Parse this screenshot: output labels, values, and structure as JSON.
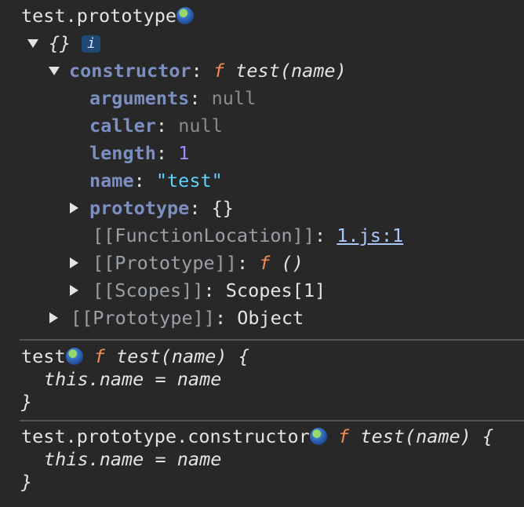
{
  "entries": [
    {
      "expression": "test.prototype",
      "tree": {
        "root": "{}",
        "info_badge": "i",
        "constructor": {
          "key": "constructor",
          "sep": ": ",
          "f": "f",
          "sig": "test(name)"
        },
        "arguments": {
          "key": "arguments",
          "value": "null"
        },
        "caller": {
          "key": "caller",
          "value": "null"
        },
        "length": {
          "key": "length",
          "value": "1"
        },
        "name": {
          "key": "name",
          "value": "\"test\""
        },
        "prototype": {
          "key": "prototype",
          "value": "{}"
        },
        "function_location": {
          "key": "[[FunctionLocation]]",
          "value": "1.js:1"
        },
        "proto_inner": {
          "key": "[[Prototype]]",
          "f": "f",
          "value": "()"
        },
        "scopes": {
          "key": "[[Scopes]]",
          "value": "Scopes[1]"
        },
        "proto_outer": {
          "key": "[[Prototype]]",
          "value": "Object"
        }
      }
    },
    {
      "expression": "test",
      "f": "f",
      "sig": "test(name) {",
      "body": "this.name = name",
      "close": "}"
    },
    {
      "expression": "test.prototype.constructor",
      "f": "f",
      "sig": "test(name) {",
      "body": "this.name = name",
      "close": "}"
    }
  ],
  "sep": ": "
}
